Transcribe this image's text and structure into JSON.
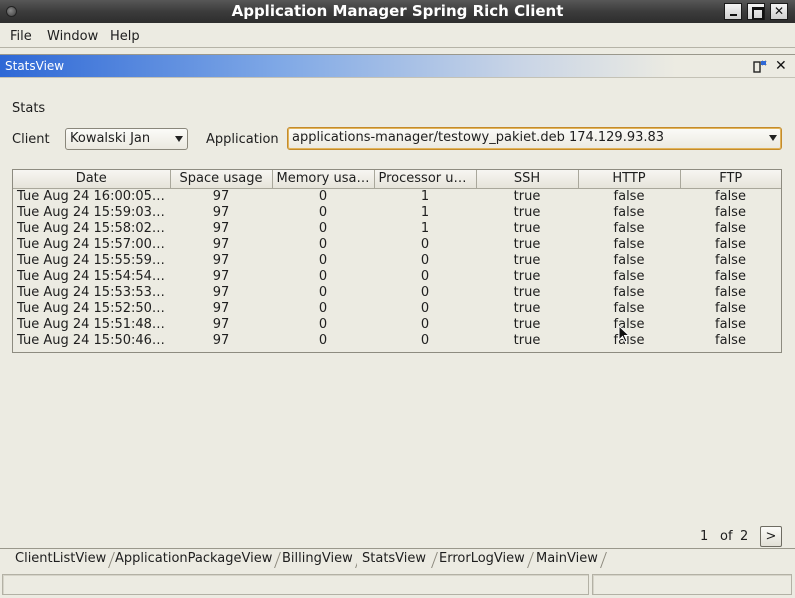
{
  "window": {
    "title": "Application Manager Spring Rich Client"
  },
  "menu": {
    "file": "File",
    "window": "Window",
    "help": "Help"
  },
  "view": {
    "title": "StatsView"
  },
  "stats": {
    "heading": "Stats",
    "client_label": "Client",
    "client_value": "Kowalski Jan",
    "application_label": "Application",
    "application_value": "applications-manager/testowy_pakiet.deb 174.129.93.83"
  },
  "table": {
    "columns": [
      "Date",
      "Space usage",
      "Memory usage",
      "Processor us...",
      "SSH",
      "HTTP",
      "FTP"
    ],
    "rows": [
      [
        "Tue Aug 24 16:00:05 ...",
        "97",
        "0",
        "1",
        "true",
        "false",
        "false"
      ],
      [
        "Tue Aug 24 15:59:03 ...",
        "97",
        "0",
        "1",
        "true",
        "false",
        "false"
      ],
      [
        "Tue Aug 24 15:58:02 ...",
        "97",
        "0",
        "1",
        "true",
        "false",
        "false"
      ],
      [
        "Tue Aug 24 15:57:00 ...",
        "97",
        "0",
        "0",
        "true",
        "false",
        "false"
      ],
      [
        "Tue Aug 24 15:55:59 ...",
        "97",
        "0",
        "0",
        "true",
        "false",
        "false"
      ],
      [
        "Tue Aug 24 15:54:54 ...",
        "97",
        "0",
        "0",
        "true",
        "false",
        "false"
      ],
      [
        "Tue Aug 24 15:53:53 ...",
        "97",
        "0",
        "0",
        "true",
        "false",
        "false"
      ],
      [
        "Tue Aug 24 15:52:50 ...",
        "97",
        "0",
        "0",
        "true",
        "false",
        "false"
      ],
      [
        "Tue Aug 24 15:51:48 ...",
        "97",
        "0",
        "0",
        "true",
        "false",
        "false"
      ],
      [
        "Tue Aug 24 15:50:46 ...",
        "97",
        "0",
        "0",
        "true",
        "false",
        "false"
      ]
    ]
  },
  "pager": {
    "current": "1",
    "of_label": "of",
    "total": "2",
    "next_label": ">"
  },
  "tabs": [
    "ClientListView",
    "ApplicationPackageView",
    "BillingView",
    "StatsView",
    "ErrorLogView",
    "MainView"
  ],
  "colors": {
    "titlebar": "#3c3c3c",
    "view_header_accent": "#2e68d6",
    "background": "#ecebe2",
    "focus_border": "#c48b2c"
  },
  "icons": {
    "window_menu": "window-menu-icon",
    "minimize": "minimize-icon",
    "maximize": "maximize-icon",
    "close": "close-icon",
    "restore_view": "restore-view-icon",
    "close_view": "close-view-icon",
    "dropdown": "chevron-down-icon"
  }
}
